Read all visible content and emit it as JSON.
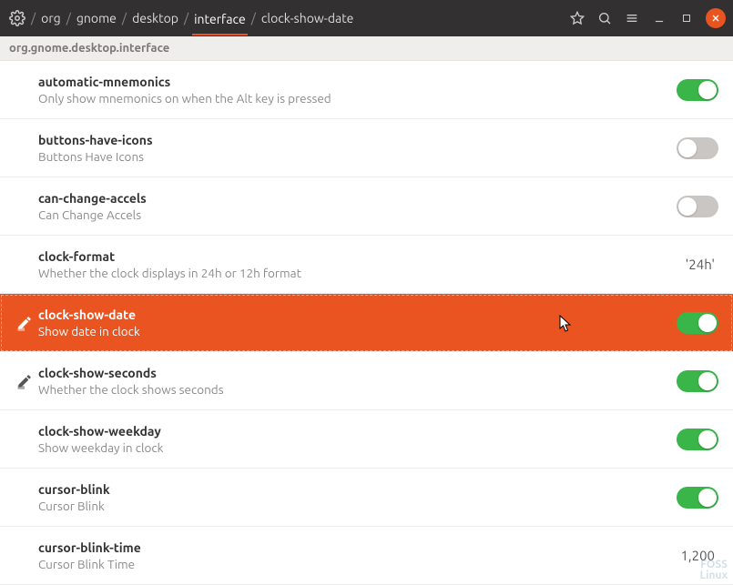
{
  "header": {
    "breadcrumb": [
      "org",
      "gnome",
      "desktop",
      "interface",
      "clock-show-date"
    ],
    "active_index": 3
  },
  "schema": "org.gnome.desktop.interface",
  "settings": [
    {
      "key": "automatic-mnemonics",
      "desc": "Only show mnemonics on when the Alt key is pressed",
      "type": "toggle",
      "value": true,
      "modified": false,
      "selected": false
    },
    {
      "key": "buttons-have-icons",
      "desc": "Buttons Have Icons",
      "type": "toggle",
      "value": false,
      "modified": false,
      "selected": false
    },
    {
      "key": "can-change-accels",
      "desc": "Can Change Accels",
      "type": "toggle",
      "value": false,
      "modified": false,
      "selected": false
    },
    {
      "key": "clock-format",
      "desc": "Whether the clock displays in 24h or 12h format",
      "type": "value",
      "value": "'24h'",
      "modified": false,
      "selected": false
    },
    {
      "key": "clock-show-date",
      "desc": "Show date in clock",
      "type": "toggle",
      "value": true,
      "modified": true,
      "selected": true
    },
    {
      "key": "clock-show-seconds",
      "desc": "Whether the clock shows seconds",
      "type": "toggle",
      "value": true,
      "modified": true,
      "selected": false
    },
    {
      "key": "clock-show-weekday",
      "desc": "Show weekday in clock",
      "type": "toggle",
      "value": true,
      "modified": false,
      "selected": false
    },
    {
      "key": "cursor-blink",
      "desc": "Cursor Blink",
      "type": "toggle",
      "value": true,
      "modified": false,
      "selected": false
    },
    {
      "key": "cursor-blink-time",
      "desc": "Cursor Blink Time",
      "type": "value",
      "value": "1,200",
      "modified": false,
      "selected": false
    }
  ],
  "watermark": {
    "line1": "FOSS",
    "line2": "Linux"
  }
}
